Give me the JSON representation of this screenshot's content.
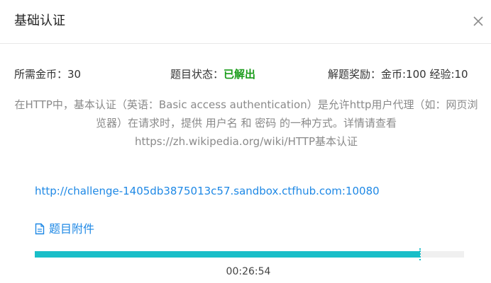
{
  "dialog": {
    "title": "基础认证",
    "close_icon": "close-icon"
  },
  "meta": {
    "cost": "所需金币：30",
    "status_label": "题目状态：",
    "status_value": "已解出",
    "status_color": "#1a9c1a",
    "reward": "解题奖励：金币:100 经验:10"
  },
  "description": "在HTTP中，基本认证（英语：Basic access authentication）是允许http用户代理（如：网页浏览器）在请求时，提供 用户名 和 密码 的一种方式。详情请查看 https://zh.wikipedia.org/wiki/HTTP基本认证",
  "challenge_url": "http://challenge-1405db3875013c57.sandbox.ctfhub.com:10080",
  "attachment": {
    "label": "题目附件",
    "icon": "file-icon"
  },
  "timer": {
    "progress": 0.897,
    "accent_color": "#19bec8",
    "remaining": "00:26:54"
  }
}
